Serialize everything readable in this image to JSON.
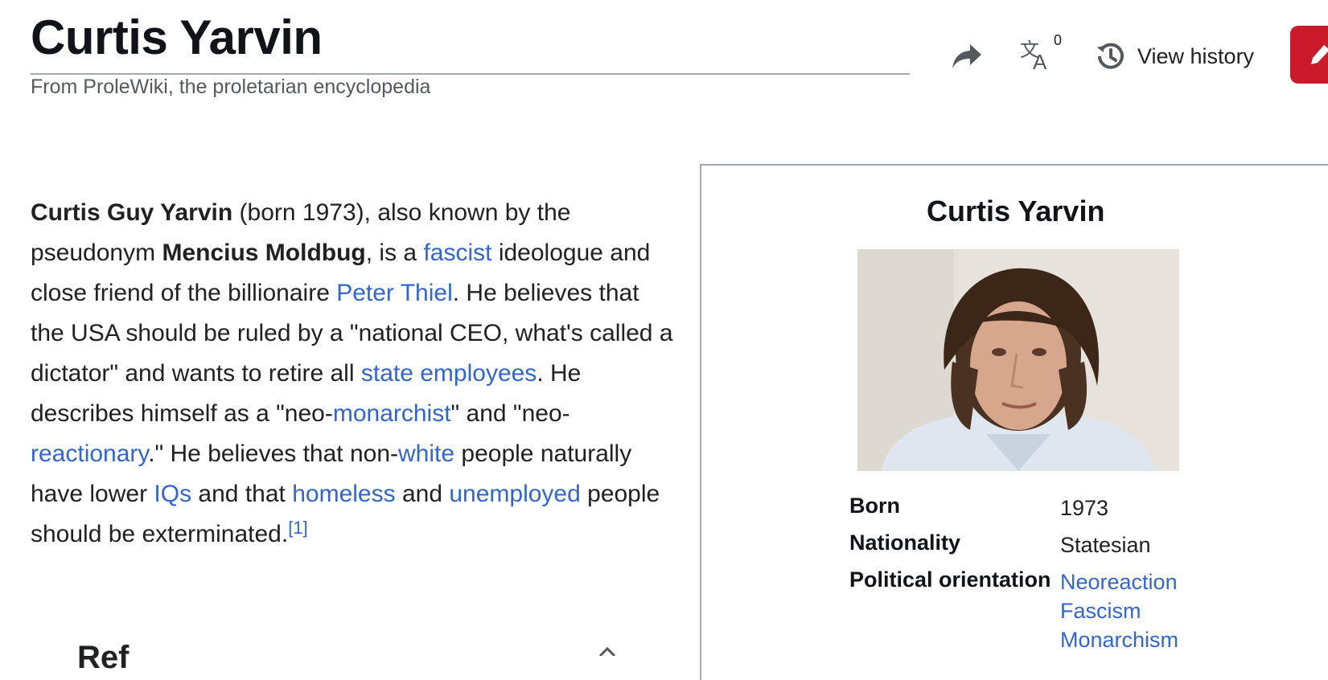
{
  "page": {
    "title": "Curtis Yarvin",
    "tagline": "From ProleWiki, the proletarian encyclopedia"
  },
  "toolbar": {
    "share_icon": "share-arrow-icon",
    "language_icon": "translate-icon",
    "language_count": "0",
    "history_icon": "history-clock-icon",
    "history_label": "View history",
    "edit_icon": "pencil-icon"
  },
  "intro": {
    "subject_name": "Curtis Guy Yarvin",
    "t1": " (born 1973), also known by the pseudonym ",
    "pseudonym": "Mencius Moldbug",
    "t2": ", is a ",
    "link_fascist": "fascist",
    "t3": " ideologue and close friend of the billionaire ",
    "link_thiel": "Peter Thiel",
    "t4": ". He believes that the USA should be ruled by a \"national CEO, what's called a dictator\" and wants to retire all ",
    "link_state_employees": "state employees",
    "t5": ". He describes himself as a \"neo-",
    "link_monarchist": "monarchist",
    "t6": "\" and \"neo-",
    "link_reactionary": "reactionary",
    "t7": ".\" He believes that non-",
    "link_white": "white",
    "t8": " people naturally have lower ",
    "link_iqs": "IQs",
    "t9": " and that ",
    "link_homeless": "homeless",
    "t10": " and ",
    "link_unemployed": "unemployed",
    "t11": " people should be exterminated.",
    "ref": "[1]"
  },
  "next_section_peek": "Ref",
  "infobox": {
    "title": "Curtis Yarvin",
    "rows": [
      {
        "label": "Born",
        "value": "1973"
      },
      {
        "label": "Nationality",
        "value": "Statesian"
      },
      {
        "label": "Political orientation",
        "links": [
          "Neoreaction",
          "Fascism",
          "Monarchism"
        ]
      }
    ]
  },
  "colors": {
    "link": "#3366cc",
    "text": "#202122",
    "edit_button": "#cc1a2d",
    "rule": "#a2a9b1"
  }
}
